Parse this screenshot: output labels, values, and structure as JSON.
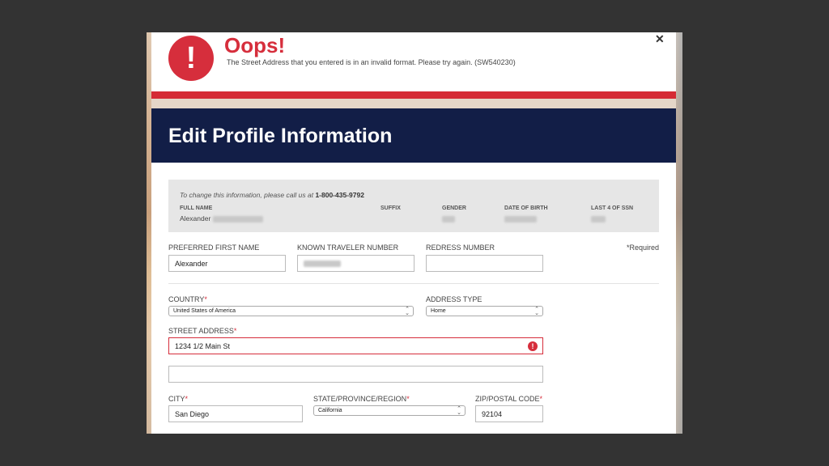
{
  "alert": {
    "icon_glyph": "!",
    "title": "Oops!",
    "message": "The Street Address that you entered is in an invalid format. Please try again. (SW540230)",
    "close_glyph": "✕"
  },
  "header": {
    "title": "Edit Profile Information"
  },
  "info": {
    "note": "To change this information, please call us at",
    "phone": "1-800-435-9792",
    "columns": {
      "full_name": "FULL NAME",
      "suffix": "SUFFIX",
      "gender": "GENDER",
      "dob": "DATE OF BIRTH",
      "ssn": "LAST 4 OF SSN"
    },
    "full_name_value": "Alexander"
  },
  "form": {
    "required_note": "*Required",
    "preferred_first_name": {
      "label": "PREFERRED FIRST NAME",
      "value": "Alexander"
    },
    "known_traveler_number": {
      "label": "KNOWN TRAVELER NUMBER"
    },
    "redress_number": {
      "label": "REDRESS NUMBER",
      "value": ""
    },
    "country": {
      "label": "COUNTRY",
      "value": "United States of America"
    },
    "address_type": {
      "label": "ADDRESS TYPE",
      "value": "Home"
    },
    "street_address": {
      "label": "STREET ADDRESS",
      "value": "1234 1/2 Main St",
      "line2": ""
    },
    "city": {
      "label": "CITY",
      "value": "San Diego"
    },
    "state": {
      "label": "STATE/PROVINCE/REGION",
      "value": "California"
    },
    "zip": {
      "label": "ZIP/POSTAL CODE",
      "value": "92104"
    },
    "required_mark": "*"
  },
  "colors": {
    "accent_red": "#d62e3c",
    "header_navy": "#121e47"
  }
}
